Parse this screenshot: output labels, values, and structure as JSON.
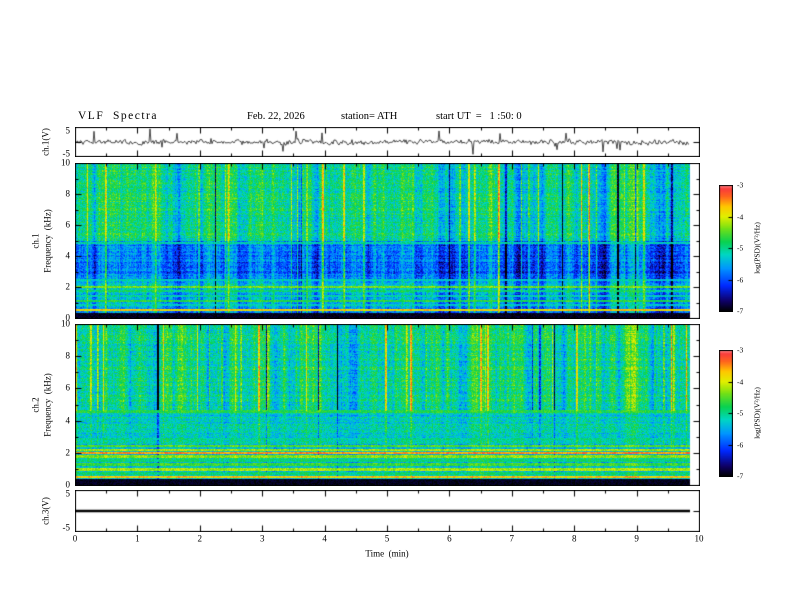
{
  "header": {
    "title": "VLF  Spectra",
    "date": "Feb. 22, 2026",
    "station": "station= ATH",
    "start_ut": "start UT  =   1 :50: 0"
  },
  "panels": {
    "ch1_wave": {
      "label": "ch.1(V)",
      "ymax": "5",
      "ymin": "-5"
    },
    "ch1_spec": {
      "channel": "ch.1",
      "axis_label": "Frequency  (kHz)",
      "yticks": [
        "10",
        "8",
        "6",
        "4",
        "2",
        "0"
      ]
    },
    "ch2_spec": {
      "channel": "ch.2",
      "axis_label": "Frequency  (kHz)",
      "yticks": [
        "10",
        "8",
        "6",
        "4",
        "2",
        "0"
      ]
    },
    "ch3_wave": {
      "label": "ch.3(V)",
      "ymax": "5",
      "ymin": "-5"
    }
  },
  "xaxis": {
    "label": "Time  (min)",
    "ticks": [
      "0",
      "1",
      "2",
      "3",
      "4",
      "5",
      "6",
      "7",
      "8",
      "9",
      "10"
    ]
  },
  "colorbar": {
    "label": "log(PSD)(V²/Hz)",
    "ticks": [
      "-3",
      "-4",
      "-5",
      "-6",
      "-7"
    ]
  },
  "colors": {
    "background": "#ffffff",
    "frame": "#000000",
    "trace": "#000000",
    "colormap": "jet-like: black floor, blue, cyan, green, yellow, orange, red/pink peak"
  },
  "chart_data": [
    {
      "id": "ch1_waveform",
      "type": "line",
      "ylabel": "ch.1(V)",
      "x_range": [
        0,
        10
      ],
      "x_unit": "min",
      "y_range": [
        -5,
        5
      ],
      "data_end_fraction": 0.985,
      "summary": "broadband noise trace around 0 V (~plus/minus 1 V) with frequent impulsive spikes reaching about plus/minus 4 V"
    },
    {
      "id": "ch1_spectrogram",
      "type": "heatmap",
      "ylabel": "ch.1 Frequency (kHz)",
      "x_range": [
        0,
        10
      ],
      "y_range": [
        0,
        10
      ],
      "z_range": [
        -7,
        -3
      ],
      "z_label": "log(PSD)(V²/Hz)",
      "data_end_fraction": 0.985,
      "bands": [
        {
          "f_khz": [
            5,
            10
          ],
          "level": -5.05
        },
        {
          "f_khz": [
            2.4,
            5
          ],
          "level": -5.9
        },
        {
          "f_khz": [
            1,
            2.4
          ],
          "level": -5.5
        },
        {
          "f_khz": [
            0.35,
            1
          ],
          "level": -5.7
        },
        {
          "f_khz": [
            0,
            0.35
          ],
          "level": -6.9
        }
      ],
      "horizontal_lines": [
        {
          "f_khz": 4.85,
          "level": -5.1
        },
        {
          "f_khz": 2.5,
          "level": -5.2
        },
        {
          "f_khz": 2.05,
          "level": -4.4
        },
        {
          "f_khz": 1.75,
          "level": -4.9
        },
        {
          "f_khz": 1.45,
          "level": -5.1
        },
        {
          "f_khz": 1.15,
          "level": -4.7
        },
        {
          "f_khz": 0.85,
          "level": -5.2
        },
        {
          "f_khz": 0.55,
          "level": -3.8
        }
      ],
      "streaks": {
        "full_above": 0,
        "below_scale": 1
      },
      "summary": "green/teal background with dense vertical bright and dark streaks; distinct blue band 2.4-5 kHz; bright horizontal lines below 2.5 kHz; black band below 0.35 kHz"
    },
    {
      "id": "ch2_spectrogram",
      "type": "heatmap",
      "ylabel": "ch.2 Frequency (kHz)",
      "x_range": [
        0,
        10
      ],
      "y_range": [
        0,
        10
      ],
      "z_range": [
        -7,
        -3
      ],
      "z_label": "log(PSD)(V²/Hz)",
      "data_end_fraction": 0.985,
      "bands": [
        {
          "f_khz": [
            4.6,
            10
          ],
          "level": -5.0
        },
        {
          "f_khz": [
            2.6,
            4.6
          ],
          "level": -5.2
        },
        {
          "f_khz": [
            0.4,
            2.6
          ],
          "level": -5.3
        },
        {
          "f_khz": [
            0,
            0.4
          ],
          "level": -6.9
        }
      ],
      "horizontal_lines": [
        {
          "f_khz": 4.6,
          "level": -4.7
        },
        {
          "f_khz": 2.9,
          "level": -5.0
        },
        {
          "f_khz": 2.45,
          "level": -4.5
        },
        {
          "f_khz": 2.2,
          "level": -4.2
        },
        {
          "f_khz": 2.0,
          "level": -3.5
        },
        {
          "f_khz": 1.8,
          "level": -4.3
        },
        {
          "f_khz": 1.55,
          "level": -4.9
        },
        {
          "f_khz": 1.3,
          "level": -4.6
        },
        {
          "f_khz": 1.0,
          "level": -4.2
        },
        {
          "f_khz": 0.75,
          "level": -4.9
        },
        {
          "f_khz": 0.55,
          "level": -3.7
        }
      ],
      "streaks": {
        "full_above": 4.6,
        "below_scale": 0.35
      },
      "summary": "vertical streaks mainly above 4.6 kHz; smoother cyan/green below with strong yellow/red horizontal lines near 2 kHz and 1 kHz; black band below 0.4 kHz"
    },
    {
      "id": "ch3_waveform",
      "type": "line",
      "ylabel": "ch.3(V)",
      "x_range": [
        0,
        10
      ],
      "y_range": [
        -5,
        5
      ],
      "data_end_fraction": 0.985,
      "summary": "flat thick line at 0 V (no signal on channel 3)"
    }
  ]
}
